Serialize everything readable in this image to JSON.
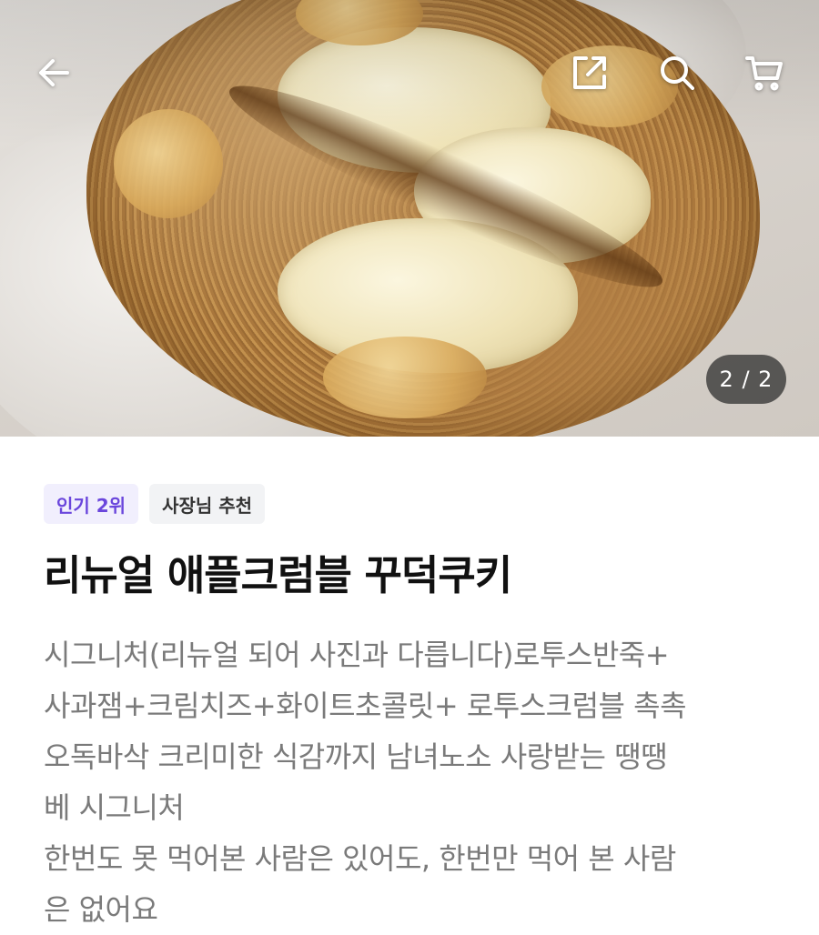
{
  "header": {
    "back_icon": "arrow-left-icon",
    "share_icon": "share-icon",
    "search_icon": "search-icon",
    "cart_icon": "cart-icon"
  },
  "gallery": {
    "counter": "2 / 2"
  },
  "product": {
    "badges": [
      {
        "label": "인기 2위",
        "color": "#6a46dc",
        "bg": "#f1effd"
      },
      {
        "label": "사장님 추천",
        "color": "#333333",
        "bg": "#f2f3f5"
      }
    ],
    "title": "리뉴얼 애플크럼블 꾸덕쿠키",
    "description_lines": [
      "시그니처(리뉴얼 되어 사진과 다릅니다)로투스반죽+",
      "사과잼+크림치즈+화이트초콜릿+ 로투스크럼블 촉촉",
      "오독바삭 크리미한 식감까지 남녀노소 사랑받는 땡땡",
      "베 시그니처",
      "한번도 못 먹어본 사람은 있어도, 한번만 먹어 본 사람",
      "은 없어요"
    ]
  }
}
